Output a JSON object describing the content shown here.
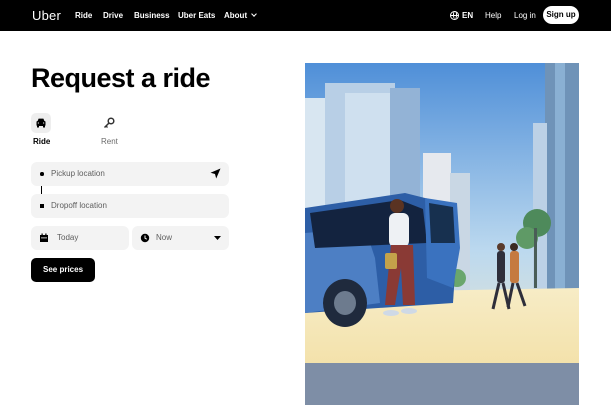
{
  "nav": {
    "logo": "Uber",
    "links": [
      "Ride",
      "Drive",
      "Business",
      "Uber Eats",
      "About"
    ],
    "language": "EN",
    "help": "Help",
    "login": "Log in",
    "signup": "Sign up"
  },
  "main": {
    "title": "Request a ride",
    "tabs": [
      {
        "label": "Ride",
        "icon": "car-icon",
        "active": true
      },
      {
        "label": "Rent",
        "icon": "key-icon",
        "active": false
      }
    ],
    "pickup_placeholder": "Pickup location",
    "dropoff_placeholder": "Dropoff location",
    "date_value": "Today",
    "time_value": "Now",
    "see_prices": "See prices"
  },
  "colors": {
    "nav_bg": "#000000",
    "field_bg": "#f3f3f3",
    "button_bg": "#000000"
  }
}
